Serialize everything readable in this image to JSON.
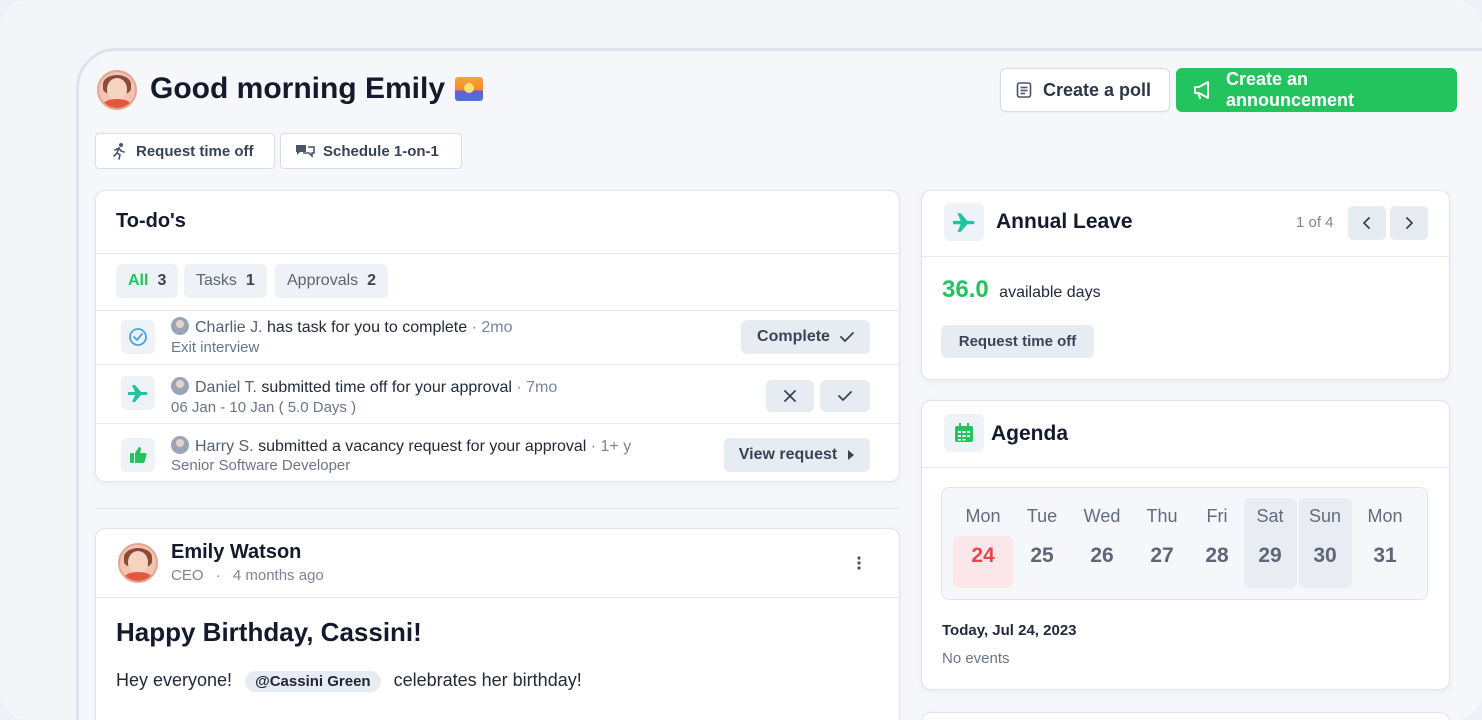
{
  "header": {
    "greeting": "Good morning Emily",
    "create_poll_label": "Create a poll",
    "create_announcement_label": "Create an announcement"
  },
  "quick_actions": {
    "request_time_off": "Request time off",
    "schedule_one_on_one": "Schedule 1-on-1"
  },
  "todos": {
    "title": "To-do's",
    "filters": [
      {
        "label": "All",
        "count": "3"
      },
      {
        "label": "Tasks",
        "count": "1"
      },
      {
        "label": "Approvals",
        "count": "2"
      }
    ],
    "items": [
      {
        "person": "Charlie J.",
        "action": "has task for you to complete",
        "time": "· 2mo",
        "sub": "Exit interview",
        "button": "Complete"
      },
      {
        "person": "Daniel T.",
        "action": "submitted time off for your approval",
        "time": "· 7mo",
        "sub": "06 Jan - 10 Jan ( 5.0 Days )"
      },
      {
        "person": "Harry S.",
        "action": "submitted a vacancy request for your approval",
        "time": "· 1+ y",
        "sub": "Senior Software Developer",
        "button": "View request"
      }
    ]
  },
  "leave": {
    "title": "Annual Leave",
    "pager": "1 of 4",
    "days": "36.0",
    "days_label": "available days",
    "request_button": "Request time off"
  },
  "agenda": {
    "title": "Agenda",
    "days": [
      {
        "name": "Mon",
        "num": "24"
      },
      {
        "name": "Tue",
        "num": "25"
      },
      {
        "name": "Wed",
        "num": "26"
      },
      {
        "name": "Thu",
        "num": "27"
      },
      {
        "name": "Fri",
        "num": "28"
      },
      {
        "name": "Sat",
        "num": "29"
      },
      {
        "name": "Sun",
        "num": "30"
      },
      {
        "name": "Mon",
        "num": "31"
      }
    ],
    "today_label": "Today, Jul 24, 2023",
    "no_events": "No events"
  },
  "post": {
    "author": "Emily Watson",
    "role": "CEO",
    "time": "4 months ago",
    "title": "Happy Birthday, Cassini!",
    "text_before": "Hey everyone!",
    "mention": "@Cassini Green",
    "text_after": "celebrates her birthday!"
  },
  "colors": {
    "accent_green": "#23c45e",
    "today_red": "#e5484d",
    "teal_icon": "#1fc4a0"
  }
}
